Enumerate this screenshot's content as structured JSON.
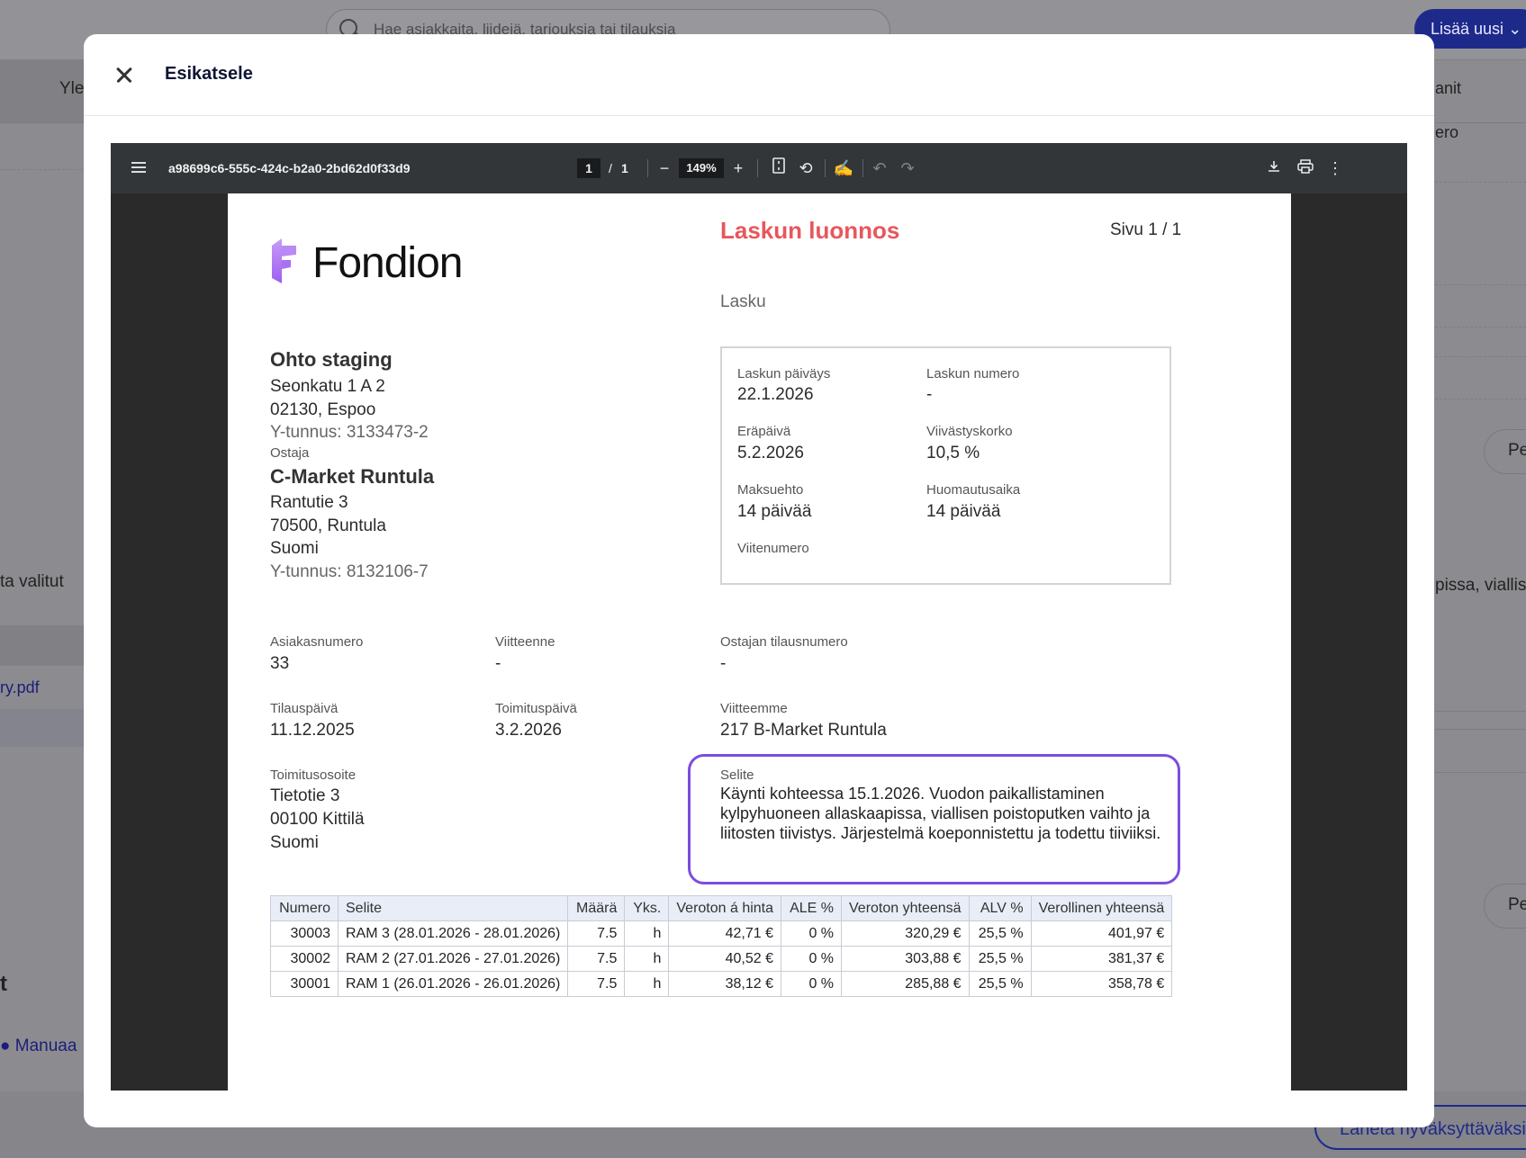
{
  "background": {
    "search_placeholder": "Hae asiakkaita, liidejä, tarjouksia tai tilauksia",
    "add_new": "Lisää uusi",
    "tab_left": "Yle",
    "tab_right": "anit",
    "right_field": "ero",
    "left_text": "ta valitut",
    "left_file": "ry.pdf",
    "right_snippet": "pissa, viallis",
    "pill_label_1": "Pe",
    "pill_label_2": "Pe",
    "section_t": "t",
    "manual_link": "Manuaa",
    "send_button": "Lähetä hyväksyttäväksi"
  },
  "modal": {
    "title": "Esikatsele"
  },
  "viewer": {
    "filename": "a98699c6-555c-424c-b2a0-2bd62d0f33d9",
    "page_current": "1",
    "page_separator": "/",
    "page_total": "1",
    "zoom": "149%"
  },
  "document": {
    "logo_text": "Fondion",
    "title": "Laskun luonnos",
    "page_info": "Sivu 1 / 1",
    "doc_type": "Lasku",
    "seller": {
      "name": "Ohto staging",
      "street": "Seonkatu 1 A 2",
      "city": "02130, Espoo",
      "business_id": "Y-tunnus: 3133473-2"
    },
    "buyer_label": "Ostaja",
    "buyer": {
      "name": "C-Market Runtula",
      "street": "Rantutie 3",
      "city": "70500, Runtula",
      "country": "Suomi",
      "business_id": "Y-tunnus: 8132106-7"
    },
    "info": {
      "invoice_date_label": "Laskun päiväys",
      "invoice_date": "22.1.2026",
      "invoice_number_label": "Laskun numero",
      "invoice_number": "-",
      "due_date_label": "Eräpäivä",
      "due_date": "5.2.2026",
      "late_interest_label": "Viivästyskorko",
      "late_interest": "10,5 %",
      "payment_terms_label": "Maksuehto",
      "payment_terms": "14 päivää",
      "notice_period_label": "Huomautusaika",
      "notice_period": "14 päivää",
      "reference_label": "Viitenumero"
    },
    "customer_number_label": "Asiakasnumero",
    "customer_number": "33",
    "your_ref_label": "Viitteenne",
    "your_ref": "-",
    "buyer_order_label": "Ostajan tilausnumero",
    "buyer_order": "-",
    "order_date_label": "Tilauspäivä",
    "order_date": "11.12.2025",
    "delivery_date_label": "Toimituspäivä",
    "delivery_date": "3.2.2026",
    "our_ref_label": "Viitteemme",
    "our_ref": "217 B-Market Runtula",
    "delivery_address_label": "Toimitusosoite",
    "delivery_address": {
      "street": "Tietotie 3",
      "city": "00100 Kittilä",
      "country": "Suomi"
    },
    "description_label": "Selite",
    "description": "Käynti kohteessa 15.1.2026. Vuodon paikallistaminen kylpyhuoneen allaskaapissa, viallisen poistoputken vaihto ja liitosten tiivistys. Järjestelmä koeponnistettu ja todettu tiiviiksi.",
    "table": {
      "headers": [
        "Numero",
        "Selite",
        "Määrä",
        "Yks.",
        "Veroton á hinta",
        "ALE %",
        "Veroton yhteensä",
        "ALV %",
        "Verollinen yhteensä"
      ],
      "rows": [
        [
          "30003",
          "RAM 3 (28.01.2026 - 28.01.2026)",
          "7.5",
          "h",
          "42,71 €",
          "0 %",
          "320,29 €",
          "25,5 %",
          "401,97 €"
        ],
        [
          "30002",
          "RAM 2 (27.01.2026 - 27.01.2026)",
          "7.5",
          "h",
          "40,52 €",
          "0 %",
          "303,88 €",
          "25,5 %",
          "381,37 €"
        ],
        [
          "30001",
          "RAM 1 (26.01.2026 - 26.01.2026)",
          "7.5",
          "h",
          "38,12 €",
          "0 %",
          "285,88 €",
          "25,5 %",
          "358,78 €"
        ]
      ]
    }
  },
  "colors": {
    "accent": "#1e2a8a",
    "draft_title": "#e8565c",
    "highlight": "#7c4ddd",
    "logo": "#b06cf0"
  }
}
